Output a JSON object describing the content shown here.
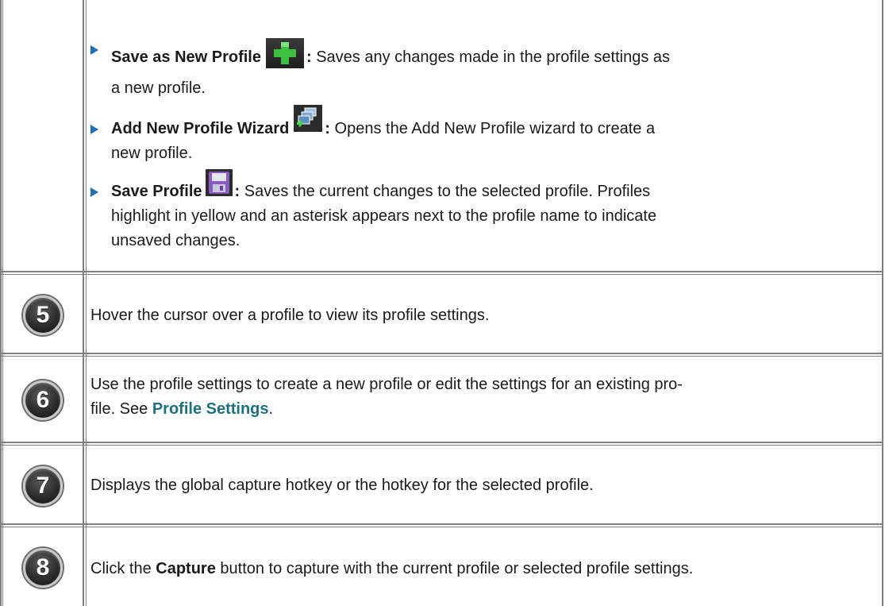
{
  "bullets": [
    {
      "label": "Save as New Profile",
      "icon": "green-plus-icon",
      "colon": ":",
      "line1": "Saves any changes made in the profile settings as",
      "line2": "a new profile."
    },
    {
      "label": "Add New Profile Wizard",
      "icon": "profile-wizard-icon",
      "colon": ":",
      "line1": "Opens the Add New Profile wizard to create a",
      "line2": "new profile."
    },
    {
      "label": "Save Profile",
      "icon": "save-disk-icon",
      "colon": ":",
      "line1": "Saves the current changes to the selected profile. Profiles",
      "line2": "highlight in yellow and an asterisk appears next to the profile name to indicate",
      "line3": "unsaved changes."
    }
  ],
  "rows": [
    {
      "number": "5",
      "text": "Hover the cursor over a profile to view its profile settings."
    },
    {
      "number": "6",
      "line1": "Use the profile settings to create a new profile or edit the settings for an existing pro-",
      "line2_pre": "file. See ",
      "link": "Profile Settings",
      "line2_post": "."
    },
    {
      "number": "7",
      "text": "Displays the global capture hotkey or the hotkey for the selected profile."
    },
    {
      "number": "8",
      "pre": "Click the ",
      "bold": "Capture",
      "post": " button to capture with the current profile or selected profile settings."
    }
  ],
  "colors": {
    "border": "#7f7f7f",
    "bullet": "#1f6fb2",
    "link": "#1c7080"
  }
}
